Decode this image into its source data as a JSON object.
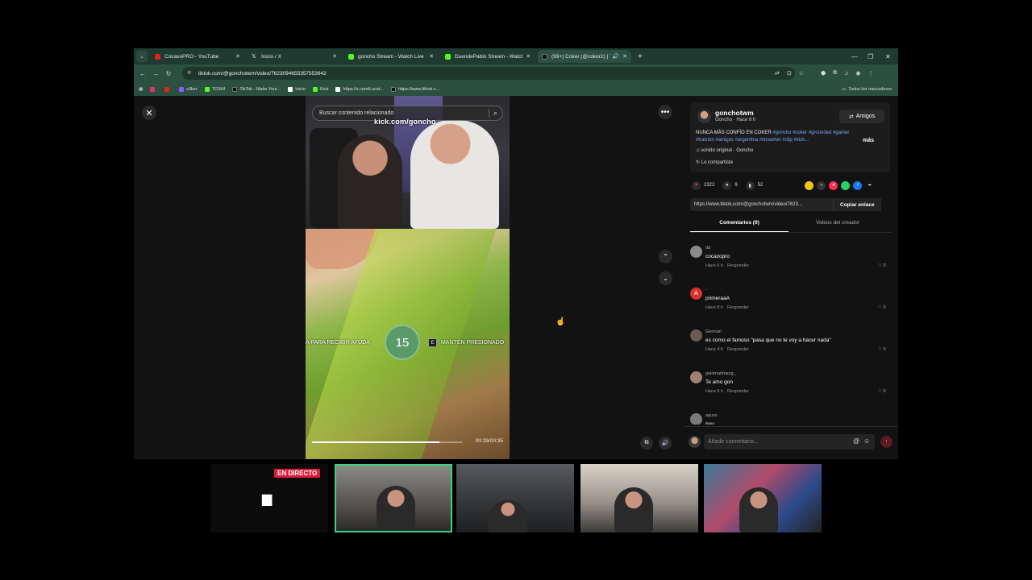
{
  "browser": {
    "tabs": [
      {
        "title": "CocasoPRO - YouTube",
        "color": "#e62117",
        "active": false
      },
      {
        "title": "Inicio / X",
        "color": "#ffffff",
        "active": false
      },
      {
        "title": "goncho Stream - Watch Live o",
        "color": "#53fc18",
        "active": false
      },
      {
        "title": "DuendePablo Stream - Watch L",
        "color": "#53fc18",
        "active": false
      },
      {
        "title": "(99+) Coker (@coker2) | Tik",
        "color": "#111111",
        "active": true
      }
    ],
    "new_tab": "+",
    "url": "tiktok.com/@gonchotwm/video/7623094655357553942",
    "bookmarks": [
      {
        "label": "",
        "color": "#e1306c"
      },
      {
        "label": "",
        "color": "#e62117"
      },
      {
        "label": "c0ker",
        "color": "#8a5cff"
      },
      {
        "label": "TOSHI",
        "color": "#53fc18"
      },
      {
        "label": "TikTok - Make Your...",
        "color": "#111111"
      },
      {
        "label": "Inicio",
        "color": "#ffffff"
      },
      {
        "label": "Kick",
        "color": "#53fc18"
      },
      {
        "label": "https://x.com/Lucst...",
        "color": "#ffffff"
      },
      {
        "label": "https://www.tiktok.c...",
        "color": "#111111"
      }
    ],
    "all_bookmarks": "Todos los marcadores"
  },
  "player": {
    "search_placeholder": "Buscar contenido relacionado",
    "watermark": "kick.com/goncho",
    "hud_left": "A PARA RECIBIR AYUDA",
    "timer": "15",
    "hud_key": "E",
    "hud_right": "MANTÉN PRESIONADO",
    "progress": 0.85,
    "time": "00:29/00:35"
  },
  "panel": {
    "author": "gonchotwm",
    "author_meta": "Goncho · Hace 8 h",
    "friends_label": "Amigos",
    "caption_text": "NUNCA MÁS CONFÍO EN COKER ",
    "caption_tags": "#goncho #coker #grounded #gamer #traicion #amigos #argentina #streamer #clip #kick...",
    "more": "más",
    "sound": "sonido original - Goncho",
    "shared": "Lo compartiste",
    "likes": "2322",
    "comments_count": "9",
    "saves": "52",
    "link": "https://www.tiktok.com/@gonchotwm/video/7623...",
    "copy_label": "Copiar enlace",
    "tab_comments": "Comentarios (9)",
    "tab_creator": "Videos del creador",
    "comments": [
      {
        "user": "dd",
        "text": "cocazopro",
        "time": "Hace 6 h",
        "reply": "Responder",
        "likes": "0",
        "avatar": "#8a8a8a"
      },
      {
        "user": "-",
        "text": "primeraaA",
        "time": "Hace 8 h",
        "reply": "Responder",
        "likes": "0",
        "avatar": "#d9342b"
      },
      {
        "user": "German",
        "text": "es como el famoso \"pasa que no te voy a hacer nada\"",
        "time": "Hace 4 h",
        "reply": "Responder",
        "likes": "0",
        "avatar": "#6b5a52"
      },
      {
        "user": "galomartinezg_",
        "text": "Te amo gon",
        "time": "Hace 6 h",
        "reply": "Responder",
        "likes": "0",
        "avatar": "#a08070"
      },
      {
        "user": "aguss",
        "text": "nuu",
        "time": "",
        "reply": "",
        "likes": "",
        "avatar": "#7a7a7a"
      }
    ],
    "comment_placeholder": "Añadir comentario...",
    "accent": "#fe2c55"
  },
  "strip": {
    "live_label": "EN DIRECTO"
  }
}
